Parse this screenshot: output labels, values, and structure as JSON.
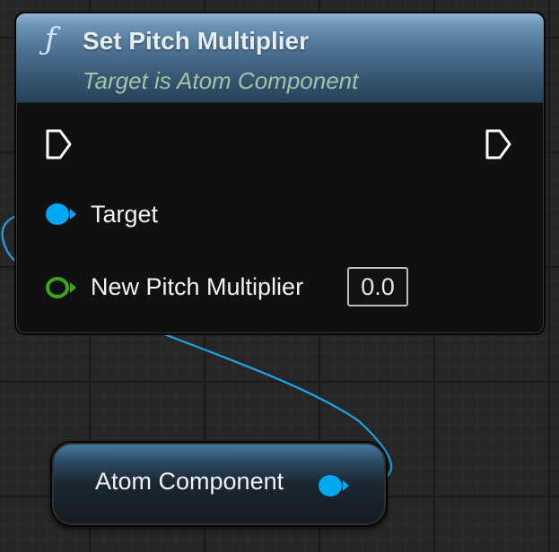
{
  "function_node": {
    "icon": "function-icon",
    "icon_glyph": "ƒ",
    "title": "Set Pitch Multiplier",
    "subtitle": "Target is Atom Component",
    "pins": {
      "exec_in": "exec-in-pin",
      "exec_out": "exec-out-pin",
      "target_label": "Target",
      "new_pitch_multiplier_label": "New Pitch Multiplier",
      "new_pitch_multiplier_value": "0.0"
    },
    "colors": {
      "header": "#4b7191",
      "object_pin": "#00a8f3",
      "float_pin": "#3ea51a",
      "exec_pin": "#ffffff"
    }
  },
  "variable_node": {
    "label": "Atom Component",
    "pin_color": "#00a8f3"
  },
  "wire": {
    "color": "#1ea3e6"
  }
}
